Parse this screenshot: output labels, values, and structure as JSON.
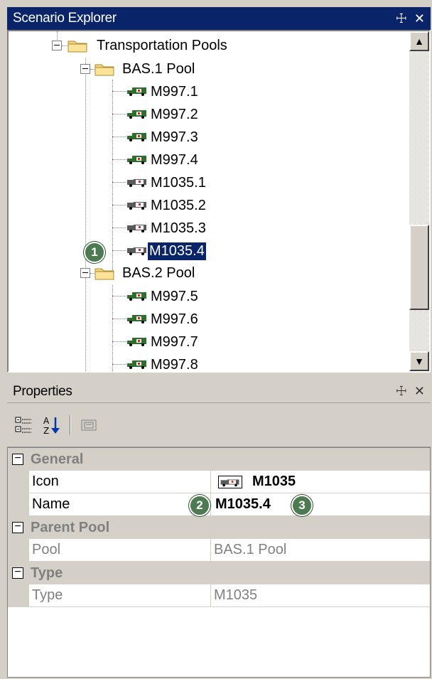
{
  "explorer": {
    "title": "Scenario Explorer",
    "pin_glyph": "☩",
    "close_glyph": "✕",
    "tree": {
      "root_label": "Transportation Pools",
      "pool1_label": "BAS.1 Pool",
      "pool1_items": [
        "M997.1",
        "M997.2",
        "M997.3",
        "M997.4",
        "M1035.1",
        "M1035.2",
        "M1035.3",
        "M1035.4"
      ],
      "pool2_label": "BAS.2 Pool",
      "pool2_items": [
        "M997.5",
        "M997.6",
        "M997.7",
        "M997.8"
      ],
      "selected_item": "M1035.4"
    }
  },
  "properties": {
    "title": "Properties",
    "categories": {
      "general": "General",
      "parent_pool": "Parent Pool",
      "type": "Type"
    },
    "rows": {
      "icon_name": "Icon",
      "icon_value": "M1035",
      "name_name": "Name",
      "name_value": "M1035.4",
      "pool_name": "Pool",
      "pool_value": "BAS.1 Pool",
      "type_name": "Type",
      "type_value": "M1035"
    }
  },
  "annotations": {
    "badge1": "1",
    "badge2": "2",
    "badge3": "3"
  },
  "colors": {
    "titlebar_active": "#0a246a",
    "selection": "#0a246a",
    "badge": "#4e7a52",
    "m997_icon": "#2e6e2a",
    "m1035_icon": "#5a5a5a"
  }
}
